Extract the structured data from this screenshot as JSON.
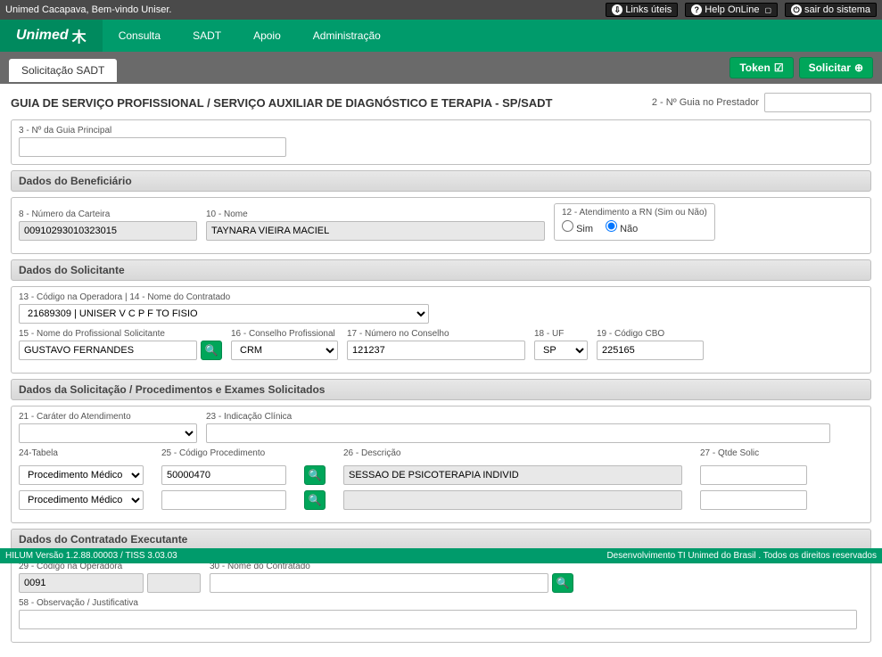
{
  "topbar": {
    "welcome": "Unimed Cacapava, Bem-vindo Uniser.",
    "links_uteis": "Links úteis",
    "help": "Help OnLine",
    "sair": "sair do sistema"
  },
  "nav": {
    "logo": "Unimed",
    "items": [
      "Consulta",
      "SADT",
      "Apoio",
      "Administração"
    ]
  },
  "subbar": {
    "tab": "Solicitação SADT",
    "token": "Token",
    "solicitar": "Solicitar"
  },
  "title": "GUIA DE SERVIÇO PROFISSIONAL / SERVIÇO AUXILIAR DE DIAGNÓSTICO E TERAPIA - SP/SADT",
  "f2": {
    "label": "2 - Nº Guia no Prestador",
    "value": ""
  },
  "f3": {
    "label": "3 - Nº da Guia Principal",
    "value": ""
  },
  "sec_benef": "Dados do Beneficiário",
  "f8": {
    "label": "8 - Número da Carteira",
    "value": "00910293010323015"
  },
  "f10": {
    "label": "10 - Nome",
    "value": "TAYNARA VIEIRA MACIEL"
  },
  "f12": {
    "label": "12 - Atendimento a RN (Sim ou Não)",
    "sim": "Sim",
    "nao": "Não",
    "value": "Não"
  },
  "sec_solic": "Dados do Solicitante",
  "f13": {
    "label": "13 - Código na Operadora | 14 - Nome do Contratado",
    "value": "21689309 | UNISER V C P F TO FISIO"
  },
  "f15": {
    "label": "15 - Nome do Profissional Solicitante",
    "value": "GUSTAVO FERNANDES"
  },
  "f16": {
    "label": "16 - Conselho Profissional",
    "value": "CRM"
  },
  "f17": {
    "label": "17 - Número no Conselho",
    "value": "121237"
  },
  "f18": {
    "label": "18 - UF",
    "value": "SP"
  },
  "f19": {
    "label": "19 - Código CBO",
    "value": "225165"
  },
  "sec_proc": "Dados da Solicitação / Procedimentos e Exames Solicitados",
  "f21": {
    "label": "21 - Caráter do Atendimento",
    "value": ""
  },
  "f23": {
    "label": "23 - Indicação Clínica",
    "value": ""
  },
  "f24": {
    "label": "24-Tabela",
    "value": "Procedimento Médico"
  },
  "f25": {
    "label": "25 - Código Procedimento"
  },
  "f26": {
    "label": "26 - Descrição"
  },
  "f27": {
    "label": "27 - Qtde Solic"
  },
  "proc_rows": [
    {
      "tabela": "Procedimento Médico",
      "codigo": "50000470",
      "descricao": "SESSAO DE PSICOTERAPIA INDIVID",
      "qtde": ""
    },
    {
      "tabela": "Procedimento Médico",
      "codigo": "",
      "descricao": "",
      "qtde": ""
    }
  ],
  "sec_exec": "Dados do Contratado Executante",
  "f29": {
    "label": "29 - Código na Operadora",
    "value": "0091"
  },
  "f30": {
    "label": "30 - Nome do Contratado",
    "value": ""
  },
  "f58": {
    "label": "58 - Observação / Justificativa",
    "value": ""
  },
  "footer": {
    "left": "HILUM Versão 1.2.88.00003 / TISS 3.03.03",
    "right": "Desenvolvimento TI Unimed do Brasil . Todos os direitos reservados"
  }
}
